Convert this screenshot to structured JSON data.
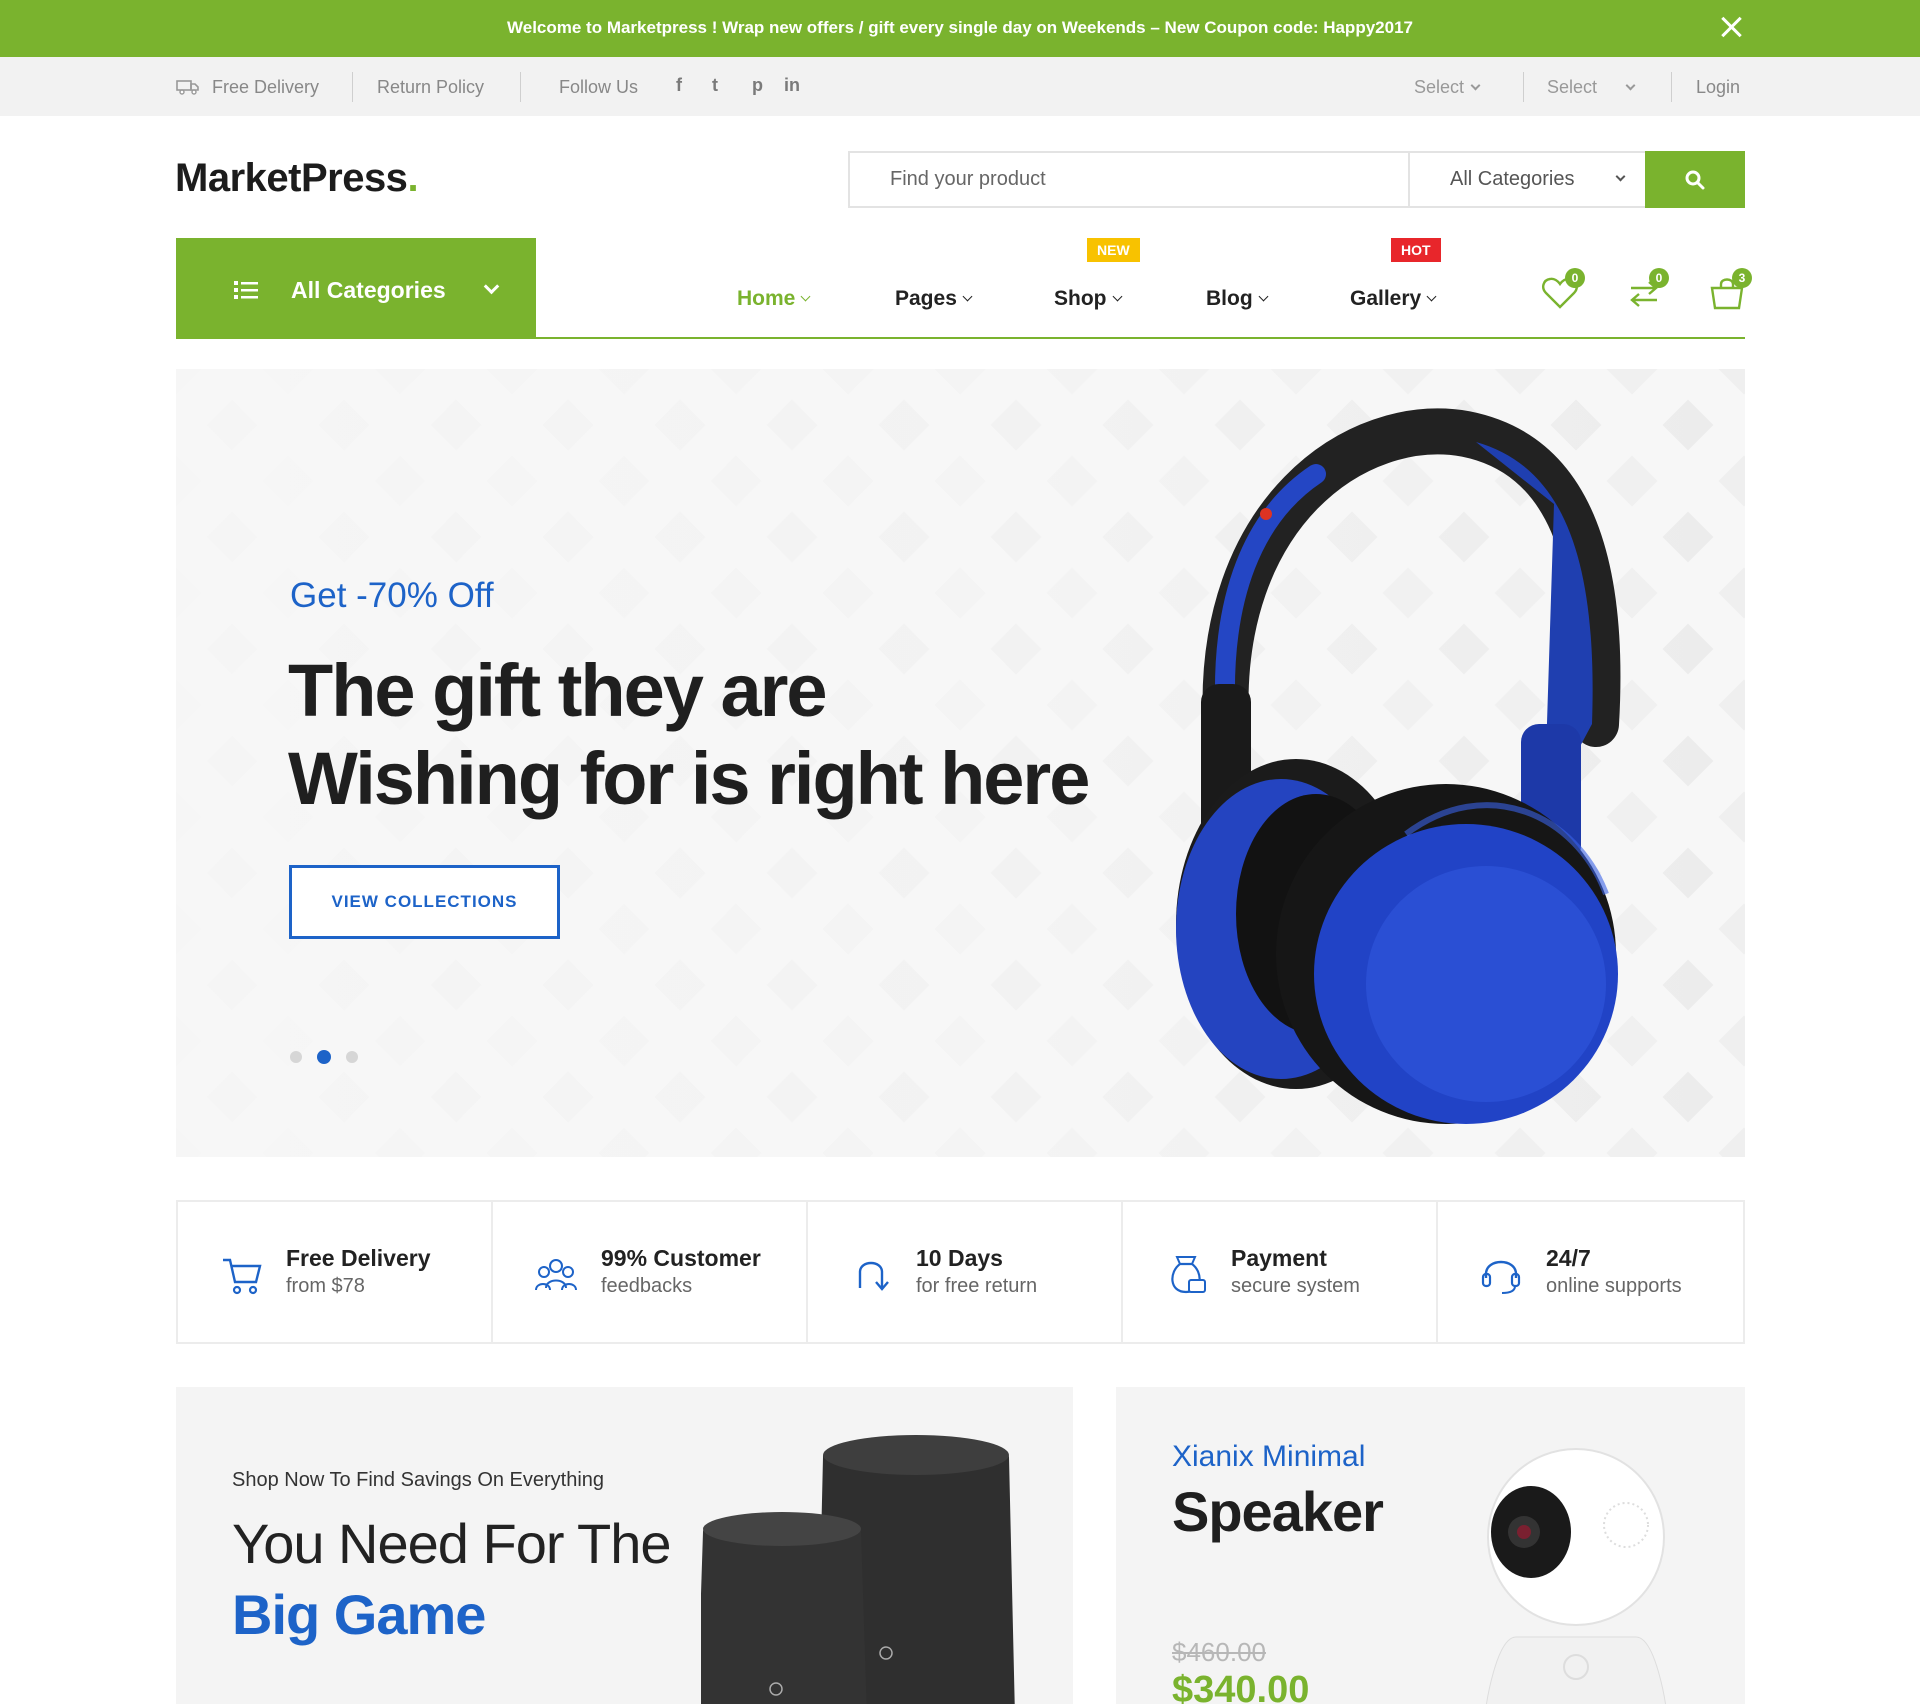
{
  "promo": {
    "text": "Welcome to Marketpress ! Wrap new offers / gift every single day on Weekends – New Coupon code: Happy2017",
    "close_icon": "close-icon"
  },
  "topbar": {
    "free_delivery": "Free Delivery",
    "return_policy": "Return Policy",
    "follow_us": "Follow Us",
    "social": [
      "f",
      "t",
      "p",
      "in"
    ],
    "select_1": "Select",
    "select_2": "Select",
    "login": "Login"
  },
  "header": {
    "logo_text": "MarketPress",
    "logo_dot": ".",
    "search_placeholder": "Find your product",
    "search_category": "All Categories",
    "search_icon": "search-icon"
  },
  "nav": {
    "all_categories": "All Categories",
    "items": [
      {
        "label": "Home",
        "active": true
      },
      {
        "label": "Pages"
      },
      {
        "label": "Shop",
        "badge": "NEW"
      },
      {
        "label": "Blog"
      },
      {
        "label": "Gallery",
        "badge": "HOT"
      }
    ],
    "wishlist_count": "0",
    "compare_count": "0",
    "cart_count": "3"
  },
  "hero": {
    "eyebrow": "Get -70% Off",
    "title_line1": "The gift they are",
    "title_line2": "Wishing for is right here",
    "button": "VIEW COLLECTIONS",
    "slides": 3,
    "active_slide": 2
  },
  "features": [
    {
      "icon": "cart-icon",
      "title": "Free Delivery",
      "sub": "from $78"
    },
    {
      "icon": "customers-icon",
      "title": "99% Customer",
      "sub": "feedbacks"
    },
    {
      "icon": "return-icon",
      "title": "10 Days",
      "sub": "for free return"
    },
    {
      "icon": "money-bag-icon",
      "title": "Payment",
      "sub": "secure system"
    },
    {
      "icon": "headset-icon",
      "title": "24/7",
      "sub": "online supports"
    }
  ],
  "banner_left": {
    "small": "Shop Now  To Find Savings On Everything",
    "line1": "You Need For The",
    "line2": "Big Game"
  },
  "banner_right": {
    "eyebrow": "Xianix Minimal",
    "title": "Speaker",
    "old_price": "$460.00",
    "new_price": "$340.00"
  },
  "colors": {
    "brand_green": "#7ab32e",
    "accent_blue": "#1d63c8",
    "badge_new": "#f8c200",
    "badge_hot": "#e8262b"
  }
}
